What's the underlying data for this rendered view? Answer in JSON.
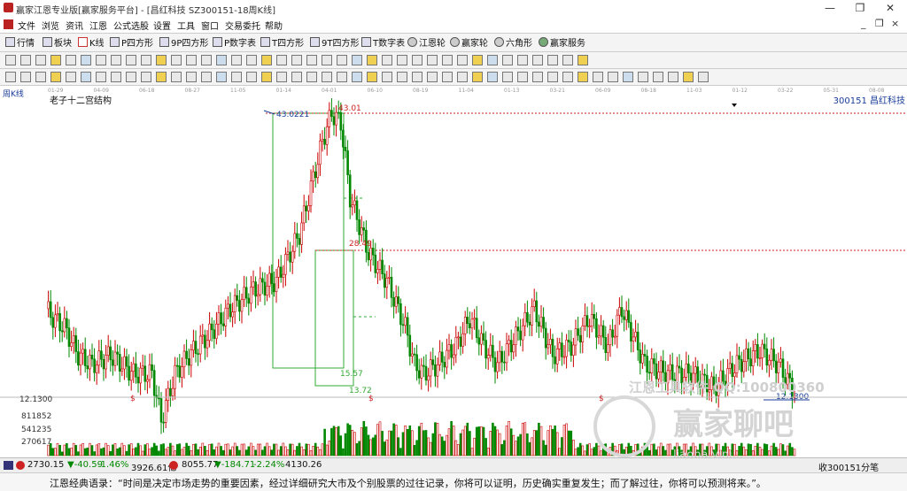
{
  "window": {
    "title": "赢家江恩专业版[赢家服务平台] - [昌红科技  SZ300151-18周K线]",
    "minimize": "—",
    "restore": "❐",
    "close": "✕"
  },
  "menu": [
    "文件",
    "浏览",
    "资讯",
    "江恩",
    "公式选股",
    "设置",
    "工具",
    "窗口",
    "交易委托",
    "帮助"
  ],
  "menu_right": [
    "_",
    "❐",
    "×"
  ],
  "toolbar": [
    "行情",
    "板块",
    "K线",
    "P四方形",
    "9P四方形",
    "P数字表",
    "T四方形",
    "9T四方形",
    "T数字表",
    "江恩轮",
    "赢家轮",
    "六角形",
    "赢家服务"
  ],
  "chart": {
    "period_label": "周K线",
    "structure_label": "老子十二宫结构",
    "stock_label": "300151  昌红科技",
    "date_ticks": [
      "01-29",
      "04-09",
      "06-18",
      "08-27",
      "11-05",
      "01-14",
      "04-01",
      "06-10",
      "08-19",
      "11-04",
      "01-13",
      "03-21",
      "06-09",
      "08-18",
      "11-03",
      "01-12",
      "03-22",
      "05-31",
      "08-08"
    ],
    "annotations": {
      "high": "43.0221",
      "high_level": "43.01",
      "mid_level": "28.49",
      "low1": "15.57",
      "low2": "13.72",
      "current": "12.1300"
    },
    "volume_ticks": [
      "12.1300",
      "811852",
      "541235",
      "270617"
    ],
    "dollar_marks": [
      "$",
      "$",
      "$"
    ],
    "colors": {
      "up": "#cc0000",
      "down": "#008800",
      "box": "#33aa33",
      "level": "#cc2222",
      "annot": "#1a3d99"
    },
    "watermarks": {
      "software": "江恩工具软件  QQ:100800360",
      "brand": "赢家聊吧",
      "url": "liaoba.yinj..."
    }
  },
  "status": {
    "idx1": "2730.15",
    "chg1": "▼-40.59",
    "pct1": "-1.46%",
    "vol1": "3926.61亿",
    "idx2": "8055.77",
    "chg2": "▼-184.71",
    "pct2": "-2.24%",
    "vol2": "4130.26",
    "right": "收300151分笔"
  },
  "quote": "江恩经典语录：“时间是决定市场走势的重要因素，经过详细研究大市及个别股票的过往记录，你将可以证明，历史确实重复发生；而了解过往，你将可以预测将来。”。"
}
